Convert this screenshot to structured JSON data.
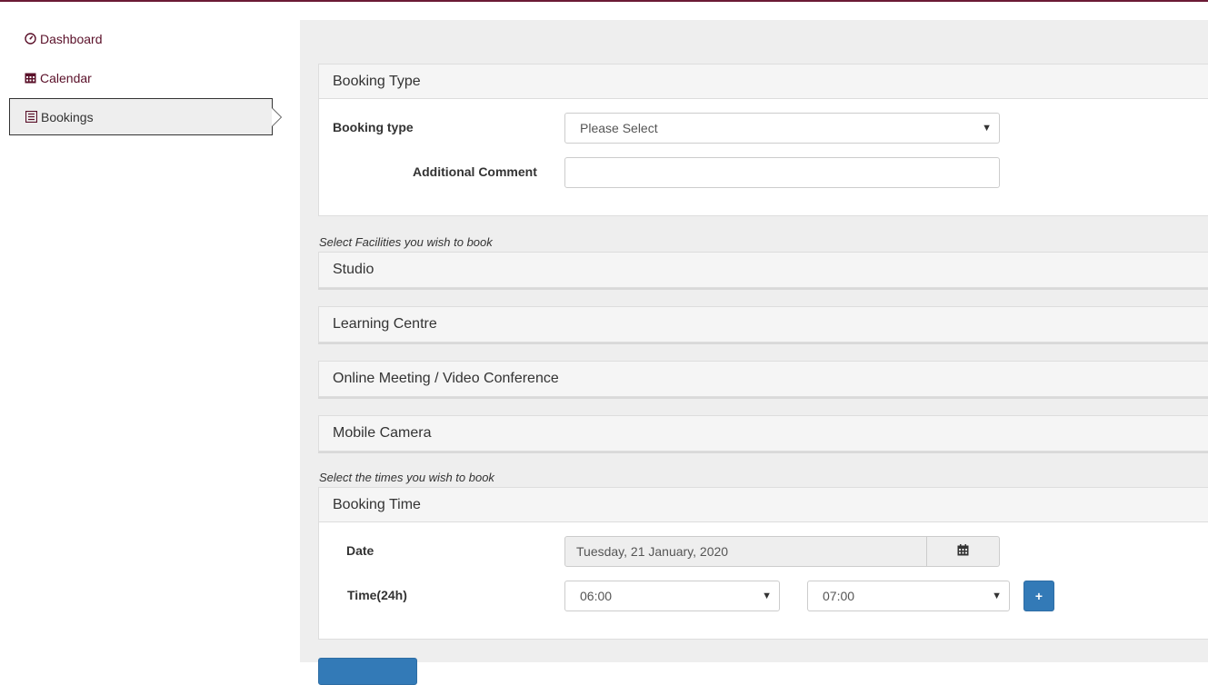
{
  "sidebar": {
    "items": [
      {
        "label": "Dashboard",
        "icon": "dashboard-icon"
      },
      {
        "label": "Calendar",
        "icon": "calendar-icon"
      },
      {
        "label": "Bookings",
        "icon": "list-icon",
        "active": true
      }
    ]
  },
  "booking_type_panel": {
    "heading": "Booking Type",
    "booking_type_label": "Booking type",
    "booking_type_value": "Please Select",
    "additional_comment_label": "Additional Comment",
    "additional_comment_value": ""
  },
  "facilities": {
    "hint": "Select Facilities you wish to book",
    "panels": [
      "Studio",
      "Learning Centre",
      "Online Meeting / Video Conference",
      "Mobile Camera"
    ]
  },
  "booking_time_panel": {
    "hint": "Select the times you wish to book",
    "heading": "Booking Time",
    "date_label": "Date",
    "date_value": "Tuesday, 21 January, 2020",
    "time_label": "Time(24h)",
    "start_time": "06:00",
    "end_time": "07:00",
    "add_label": "+"
  },
  "colors": {
    "brand": "#6b1a35",
    "primary_button": "#337ab7",
    "main_background": "#eeeeee"
  }
}
